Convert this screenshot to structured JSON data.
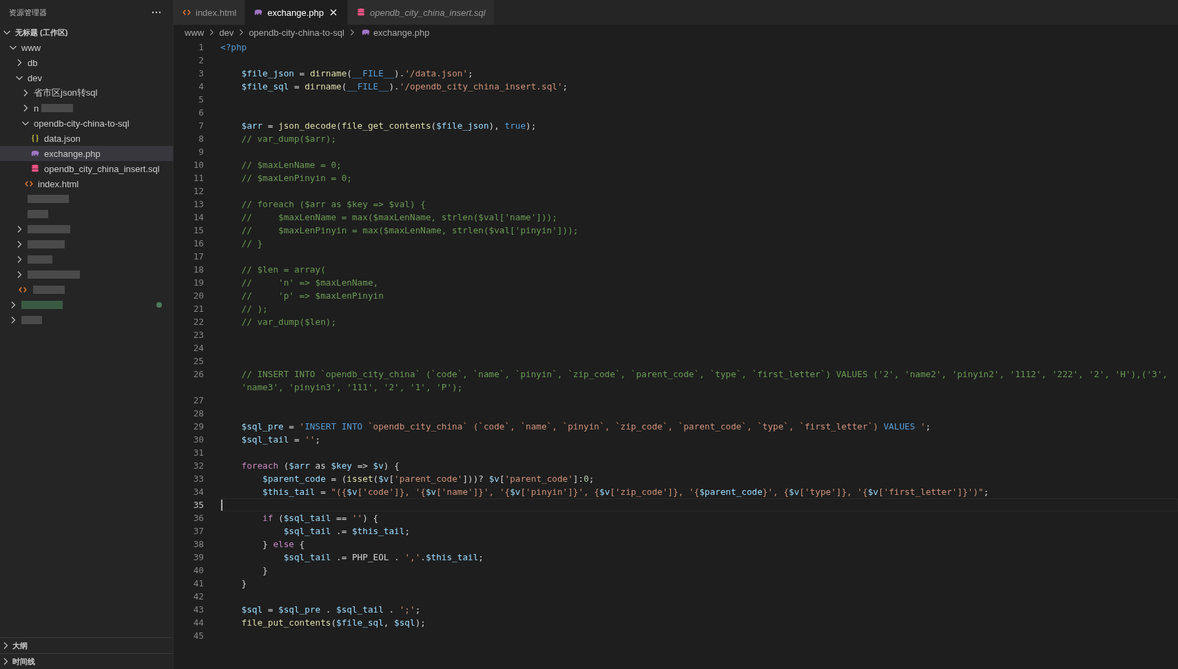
{
  "explorer": {
    "title": "资源管理器",
    "tree": [
      {
        "label": "无标题 (工作区)",
        "kind": "root",
        "expanded": true,
        "selected": false,
        "children": [
          {
            "label": "www",
            "kind": "folder",
            "expanded": true,
            "selected": false,
            "children": [
              {
                "label": "db",
                "kind": "folder",
                "expanded": false,
                "selected": false
              },
              {
                "label": "dev",
                "kind": "folder",
                "expanded": true,
                "selected": false,
                "children": [
                  {
                    "label": "省市区json转sql",
                    "kind": "folder",
                    "expanded": false,
                    "selected": false
                  },
                  {
                    "label": "n",
                    "kind": "folder",
                    "expanded": false,
                    "selected": false,
                    "redacted": true
                  },
                  {
                    "label": "opendb-city-china-to-sql",
                    "kind": "folder",
                    "expanded": true,
                    "selected": false,
                    "children": [
                      {
                        "label": "data.json",
                        "kind": "json",
                        "selected": false
                      },
                      {
                        "label": "exchange.php",
                        "kind": "php",
                        "selected": true
                      },
                      {
                        "label": "opendb_city_china_insert.sql",
                        "kind": "sql",
                        "selected": false
                      }
                    ]
                  },
                  {
                    "label": "index.html",
                    "kind": "html",
                    "selected": false
                  }
                ]
              },
              {
                "kind": "blank",
                "redacted": true,
                "selected": false
              },
              {
                "kind": "blank",
                "redacted": true,
                "selected": false
              },
              {
                "kind": "folder",
                "expanded": false,
                "redacted": true,
                "selected": false
              },
              {
                "kind": "folder",
                "expanded": false,
                "redacted": true,
                "selected": false
              },
              {
                "kind": "folder",
                "expanded": false,
                "redacted": true,
                "selected": false
              },
              {
                "kind": "folder",
                "expanded": false,
                "redacted": true,
                "selected": false
              },
              {
                "kind": "html",
                "redacted": true,
                "selected": false
              }
            ]
          },
          {
            "kind": "folder",
            "expanded": false,
            "redacted": true,
            "modified": true,
            "selected": false
          },
          {
            "kind": "folder",
            "expanded": false,
            "redacted": true,
            "selected": false
          }
        ]
      }
    ],
    "panels": [
      {
        "label": "大纲",
        "expanded": false
      },
      {
        "label": "时间线",
        "expanded": false
      }
    ]
  },
  "tabs": [
    {
      "label": "index.html",
      "kind": "html",
      "selected": false
    },
    {
      "label": "exchange.php",
      "kind": "php",
      "selected": true
    },
    {
      "label": "opendb_city_china_insert.sql",
      "kind": "sql",
      "selected": false,
      "preview": true
    }
  ],
  "breadcrumb": [
    {
      "label": "www"
    },
    {
      "label": "dev"
    },
    {
      "label": "opendb-city-china-to-sql"
    },
    {
      "label": "exchange.php",
      "kind": "php"
    }
  ],
  "code": [
    {
      "n": "1",
      "tokens": [
        {
          "kind": "tag",
          "text": "<?php"
        }
      ]
    },
    {
      "n": "2"
    },
    {
      "n": "3",
      "tokens": [
        {
          "kind": "var",
          "text": "    $file_json"
        },
        {
          "kind": "plain",
          "text": " = "
        },
        {
          "kind": "func",
          "text": "dirname"
        },
        {
          "kind": "plain",
          "text": "("
        },
        {
          "kind": "constant",
          "text": "__FILE__"
        },
        {
          "kind": "plain",
          "text": ")."
        },
        {
          "kind": "string",
          "text": "'/data.json'"
        },
        {
          "kind": "plain",
          "text": ";"
        }
      ]
    },
    {
      "n": "4",
      "tokens": [
        {
          "kind": "var",
          "text": "    $file_sql"
        },
        {
          "kind": "plain",
          "text": " = "
        },
        {
          "kind": "func",
          "text": "dirname"
        },
        {
          "kind": "plain",
          "text": "("
        },
        {
          "kind": "constant",
          "text": "__FILE__"
        },
        {
          "kind": "plain",
          "text": ")."
        },
        {
          "kind": "string",
          "text": "'/opendb_city_china_insert.sql'"
        },
        {
          "kind": "plain",
          "text": ";"
        }
      ]
    },
    {
      "n": "5"
    },
    {
      "n": "6"
    },
    {
      "n": "7",
      "tokens": [
        {
          "kind": "var",
          "text": "    $arr"
        },
        {
          "kind": "plain",
          "text": " = "
        },
        {
          "kind": "func",
          "text": "json_decode"
        },
        {
          "kind": "plain",
          "text": "("
        },
        {
          "kind": "func",
          "text": "file_get_contents"
        },
        {
          "kind": "plain",
          "text": "("
        },
        {
          "kind": "var",
          "text": "$file_json"
        },
        {
          "kind": "plain",
          "text": "), "
        },
        {
          "kind": "constant",
          "text": "true"
        },
        {
          "kind": "plain",
          "text": ");"
        }
      ]
    },
    {
      "n": "8",
      "tokens": [
        {
          "kind": "comment",
          "text": "    // var_dump($arr);"
        }
      ]
    },
    {
      "n": "9"
    },
    {
      "n": "10",
      "tokens": [
        {
          "kind": "comment",
          "text": "    // $maxLenName = 0;"
        }
      ]
    },
    {
      "n": "11",
      "tokens": [
        {
          "kind": "comment",
          "text": "    // $maxLenPinyin = 0;"
        }
      ]
    },
    {
      "n": "12"
    },
    {
      "n": "13",
      "tokens": [
        {
          "kind": "comment",
          "text": "    // foreach ($arr as $key => $val) {"
        }
      ]
    },
    {
      "n": "14",
      "tokens": [
        {
          "kind": "comment",
          "text": "    //     $maxLenName = max($maxLenName, strlen($val['name']));"
        }
      ]
    },
    {
      "n": "15",
      "tokens": [
        {
          "kind": "comment",
          "text": "    //     $maxLenPinyin = max($maxLenName, strlen($val['pinyin']));"
        }
      ]
    },
    {
      "n": "16",
      "tokens": [
        {
          "kind": "comment",
          "text": "    // }"
        }
      ]
    },
    {
      "n": "17"
    },
    {
      "n": "18",
      "tokens": [
        {
          "kind": "comment",
          "text": "    // $len = array("
        }
      ]
    },
    {
      "n": "19",
      "tokens": [
        {
          "kind": "comment",
          "text": "    //     'n' => $maxLenName,"
        }
      ]
    },
    {
      "n": "20",
      "tokens": [
        {
          "kind": "comment",
          "text": "    //     'p' => $maxLenPinyin"
        }
      ]
    },
    {
      "n": "21",
      "tokens": [
        {
          "kind": "comment",
          "text": "    // );"
        }
      ]
    },
    {
      "n": "22",
      "tokens": [
        {
          "kind": "comment",
          "text": "    // var_dump($len);"
        }
      ]
    },
    {
      "n": "23"
    },
    {
      "n": "24"
    },
    {
      "n": "25"
    },
    {
      "n": "26",
      "tokens": [
        {
          "kind": "comment",
          "text": "    // INSERT INTO `opendb_city_china` (`code`, `name`, `pinyin`, `zip_code`, `parent_code`, `type`, `first_letter`) VALUES ('2', 'name2', 'pinyin2', '1112', '222', '2', 'H'),('3',"
        }
      ],
      "continuation": [
        {
          "kind": "comment",
          "text": "    'name3', 'pinyin3', '111', '2', '1', 'P');"
        }
      ]
    },
    {
      "n": "27"
    },
    {
      "n": "28"
    },
    {
      "n": "29",
      "tokens": [
        {
          "kind": "var",
          "text": "    $sql_pre"
        },
        {
          "kind": "plain",
          "text": " = "
        },
        {
          "kind": "string",
          "text": "'"
        },
        {
          "kind": "constant",
          "text": "INSERT INTO"
        },
        {
          "kind": "string",
          "text": " `opendb_city_china` (`code`, `name`, `pinyin`, `zip_code`, `parent_code`, `type`, `first_letter`) "
        },
        {
          "kind": "constant",
          "text": "VALUES"
        },
        {
          "kind": "string",
          "text": " '"
        },
        {
          "kind": "plain",
          "text": ";"
        }
      ]
    },
    {
      "n": "30",
      "tokens": [
        {
          "kind": "var",
          "text": "    $sql_tail"
        },
        {
          "kind": "plain",
          "text": " = "
        },
        {
          "kind": "string",
          "text": "''"
        },
        {
          "kind": "plain",
          "text": ";"
        }
      ]
    },
    {
      "n": "31"
    },
    {
      "n": "32",
      "tokens": [
        {
          "kind": "keyword",
          "text": "    foreach"
        },
        {
          "kind": "plain",
          "text": " ("
        },
        {
          "kind": "var",
          "text": "$arr"
        },
        {
          "kind": "plain",
          "text": " as "
        },
        {
          "kind": "var",
          "text": "$key"
        },
        {
          "kind": "plain",
          "text": " => "
        },
        {
          "kind": "var",
          "text": "$v"
        },
        {
          "kind": "plain",
          "text": ") "
        },
        {
          "kind": "bracket",
          "text": "{"
        }
      ]
    },
    {
      "n": "33",
      "tokens": [
        {
          "kind": "var",
          "text": "        $parent_code"
        },
        {
          "kind": "plain",
          "text": " = ("
        },
        {
          "kind": "func",
          "text": "isset"
        },
        {
          "kind": "plain",
          "text": "("
        },
        {
          "kind": "var",
          "text": "$v"
        },
        {
          "kind": "plain",
          "text": "["
        },
        {
          "kind": "string",
          "text": "'parent_code'"
        },
        {
          "kind": "plain",
          "text": "]))? "
        },
        {
          "kind": "var",
          "text": "$v"
        },
        {
          "kind": "plain",
          "text": "["
        },
        {
          "kind": "string",
          "text": "'parent_code'"
        },
        {
          "kind": "plain",
          "text": "]:"
        },
        {
          "kind": "number",
          "text": "0"
        },
        {
          "kind": "plain",
          "text": ";"
        }
      ]
    },
    {
      "n": "34",
      "tokens": [
        {
          "kind": "var",
          "text": "        $this_tail"
        },
        {
          "kind": "plain",
          "text": " = "
        },
        {
          "kind": "string",
          "text": "\"({"
        },
        {
          "kind": "var",
          "text": "$v"
        },
        {
          "kind": "string",
          "text": "['code']}, '{"
        },
        {
          "kind": "var",
          "text": "$v"
        },
        {
          "kind": "string",
          "text": "['name']}', '{"
        },
        {
          "kind": "var",
          "text": "$v"
        },
        {
          "kind": "string",
          "text": "['pinyin']}', {"
        },
        {
          "kind": "var",
          "text": "$v"
        },
        {
          "kind": "string",
          "text": "['zip_code']}, '{"
        },
        {
          "kind": "var",
          "text": "$parent_code"
        },
        {
          "kind": "string",
          "text": "}', {"
        },
        {
          "kind": "var",
          "text": "$v"
        },
        {
          "kind": "string",
          "text": "['type']}, '{"
        },
        {
          "kind": "var",
          "text": "$v"
        },
        {
          "kind": "string",
          "text": "['first_letter']}')\""
        },
        {
          "kind": "plain",
          "text": ";"
        }
      ]
    },
    {
      "n": "35",
      "current": true
    },
    {
      "n": "36",
      "tokens": [
        {
          "kind": "keyword",
          "text": "        if"
        },
        {
          "kind": "plain",
          "text": " ("
        },
        {
          "kind": "var",
          "text": "$sql_tail"
        },
        {
          "kind": "plain",
          "text": " == "
        },
        {
          "kind": "string",
          "text": "''"
        },
        {
          "kind": "plain",
          "text": ") {"
        }
      ]
    },
    {
      "n": "37",
      "tokens": [
        {
          "kind": "var",
          "text": "            $sql_tail"
        },
        {
          "kind": "plain",
          "text": " .= "
        },
        {
          "kind": "var",
          "text": "$this_tail"
        },
        {
          "kind": "plain",
          "text": ";"
        }
      ]
    },
    {
      "n": "38",
      "tokens": [
        {
          "kind": "plain",
          "text": "        } "
        },
        {
          "kind": "keyword",
          "text": "else"
        },
        {
          "kind": "plain",
          "text": " {"
        }
      ]
    },
    {
      "n": "39",
      "tokens": [
        {
          "kind": "var",
          "text": "            $sql_tail"
        },
        {
          "kind": "plain",
          "text": " .= PHP_EOL . "
        },
        {
          "kind": "string",
          "text": "','"
        },
        {
          "kind": "plain",
          "text": "."
        },
        {
          "kind": "var",
          "text": "$this_tail"
        },
        {
          "kind": "plain",
          "text": ";"
        }
      ]
    },
    {
      "n": "40",
      "tokens": [
        {
          "kind": "plain",
          "text": "        }"
        }
      ]
    },
    {
      "n": "41",
      "tokens": [
        {
          "kind": "bracket",
          "text": "    }"
        }
      ]
    },
    {
      "n": "42"
    },
    {
      "n": "43",
      "tokens": [
        {
          "kind": "var",
          "text": "    $sql"
        },
        {
          "kind": "plain",
          "text": " = "
        },
        {
          "kind": "var",
          "text": "$sql_pre"
        },
        {
          "kind": "plain",
          "text": " . "
        },
        {
          "kind": "var",
          "text": "$sql_tail"
        },
        {
          "kind": "plain",
          "text": " . "
        },
        {
          "kind": "string",
          "text": "';'"
        },
        {
          "kind": "plain",
          "text": ";"
        }
      ]
    },
    {
      "n": "44",
      "tokens": [
        {
          "kind": "func",
          "text": "    file_put_contents"
        },
        {
          "kind": "plain",
          "text": "("
        },
        {
          "kind": "var",
          "text": "$file_sql"
        },
        {
          "kind": "plain",
          "text": ", "
        },
        {
          "kind": "var",
          "text": "$sql"
        },
        {
          "kind": "plain",
          "text": ");"
        }
      ]
    },
    {
      "n": "45"
    }
  ]
}
